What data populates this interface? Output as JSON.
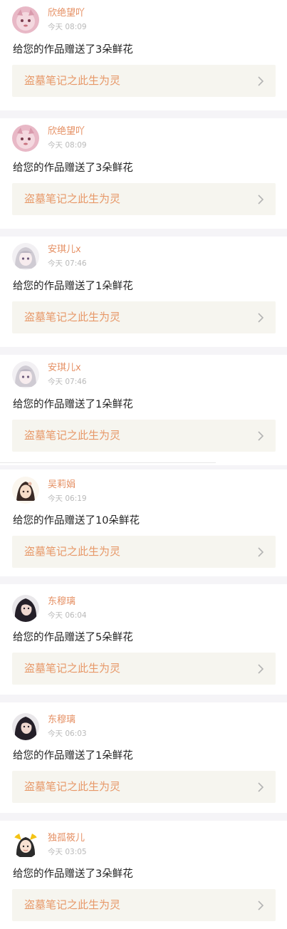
{
  "colors": {
    "accent": "#e58f63",
    "link_bg": "#f6f5ef",
    "page_bg": "#f5f4f7"
  },
  "notifications": [
    {
      "user": "欣绝望吖",
      "time": "今天 08:09",
      "message": "给您的作品赠送了3朵鲜花",
      "work": "盗墓笔记之此生为灵",
      "avatar": "pink-cat-avatar"
    },
    {
      "user": "欣绝望吖",
      "time": "今天 08:09",
      "message": "给您的作品赠送了3朵鲜花",
      "work": "盗墓笔记之此生为灵",
      "avatar": "pink-cat-avatar"
    },
    {
      "user": "安琪儿x",
      "time": "今天 07:46",
      "message": "给您的作品赠送了1朵鲜花",
      "work": "盗墓笔记之此生为灵",
      "avatar": "anime-girl-avatar"
    },
    {
      "user": "安琪儿x",
      "time": "今天 07:46",
      "message": "给您的作品赠送了1朵鲜花",
      "work": "盗墓笔记之此生为灵",
      "avatar": "anime-girl-avatar"
    },
    {
      "user": "吴莉娟",
      "time": "今天 06:19",
      "message": "给您的作品赠送了10朵鲜花",
      "work": "盗墓笔记之此生为灵",
      "avatar": "fairy-girl-avatar"
    },
    {
      "user": "东穆璃",
      "time": "今天 06:04",
      "message": "给您的作品赠送了5朵鲜花",
      "work": "盗墓笔记之此生为灵",
      "avatar": "dark-hair-girl-avatar"
    },
    {
      "user": "东穆璃",
      "time": "今天 06:03",
      "message": "给您的作品赠送了1朵鲜花",
      "work": "盗墓笔记之此生为灵",
      "avatar": "dark-hair-girl-avatar"
    },
    {
      "user": "独孤筱儿",
      "time": "今天 03:05",
      "message": "给您的作品赠送了3朵鲜花",
      "work": "盗墓笔记之此生为灵",
      "avatar": "yellow-ribbon-girl-avatar"
    }
  ]
}
